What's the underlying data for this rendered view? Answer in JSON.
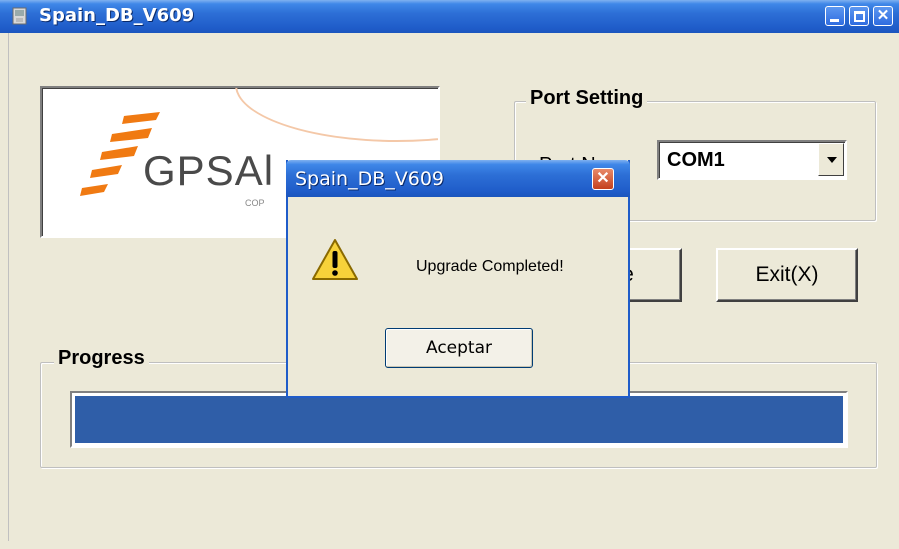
{
  "window": {
    "title": "Spain_DB_V609",
    "icons": {
      "app": "app-icon",
      "minimize": "minimize-icon",
      "maximize": "maximize-icon",
      "close": "close-icon"
    }
  },
  "logo": {
    "text": "GPSAl",
    "sub": "COP"
  },
  "port_setting": {
    "label": "Port Setting",
    "port_no_label": "Port No.",
    "port_selected": "COM1"
  },
  "buttons": {
    "update": "e",
    "exit": "Exit(X)"
  },
  "progress": {
    "label": "Progress",
    "percent": 100
  },
  "dialog": {
    "title": "Spain_DB_V609",
    "message": "Upgrade Completed!",
    "ok_label": "Aceptar",
    "icon": "warning-icon"
  },
  "colors": {
    "titlebar": "#1f5cc9",
    "progress_fill": "#2f5ea8",
    "face": "#ece9d8"
  }
}
